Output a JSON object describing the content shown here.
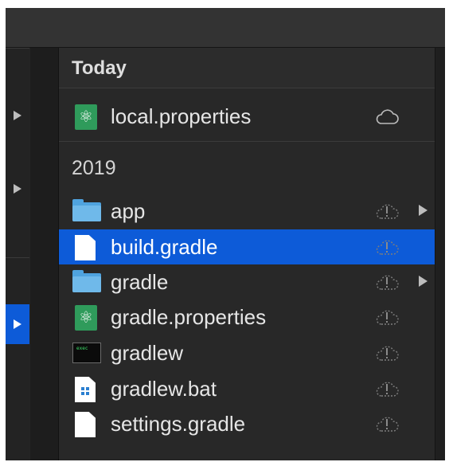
{
  "sections": [
    {
      "title": "Today",
      "items": [
        {
          "name": "local.properties",
          "icon": "atom-file-icon",
          "cloud": "cloud-icon",
          "expandable": false,
          "selected": false
        }
      ]
    },
    {
      "title": "2019",
      "items": [
        {
          "name": "app",
          "icon": "folder-icon",
          "cloud": "cloud-error-icon",
          "expandable": true,
          "selected": false
        },
        {
          "name": "build.gradle",
          "icon": "document-icon",
          "cloud": "cloud-error-icon",
          "expandable": false,
          "selected": true
        },
        {
          "name": "gradle",
          "icon": "folder-icon",
          "cloud": "cloud-error-icon",
          "expandable": true,
          "selected": false
        },
        {
          "name": "gradle.properties",
          "icon": "atom-file-icon",
          "cloud": "cloud-error-icon",
          "expandable": false,
          "selected": false
        },
        {
          "name": "gradlew",
          "icon": "terminal-icon",
          "cloud": "cloud-error-icon",
          "expandable": false,
          "selected": false
        },
        {
          "name": "gradlew.bat",
          "icon": "windows-batch-icon",
          "cloud": "cloud-error-icon",
          "expandable": false,
          "selected": false
        },
        {
          "name": "settings.gradle",
          "icon": "document-icon",
          "cloud": "cloud-error-icon",
          "expandable": false,
          "selected": false
        }
      ]
    }
  ],
  "colors": {
    "selection": "#0d5bd8",
    "folder": "#4fa3df",
    "atom": "#2f9b5b"
  }
}
